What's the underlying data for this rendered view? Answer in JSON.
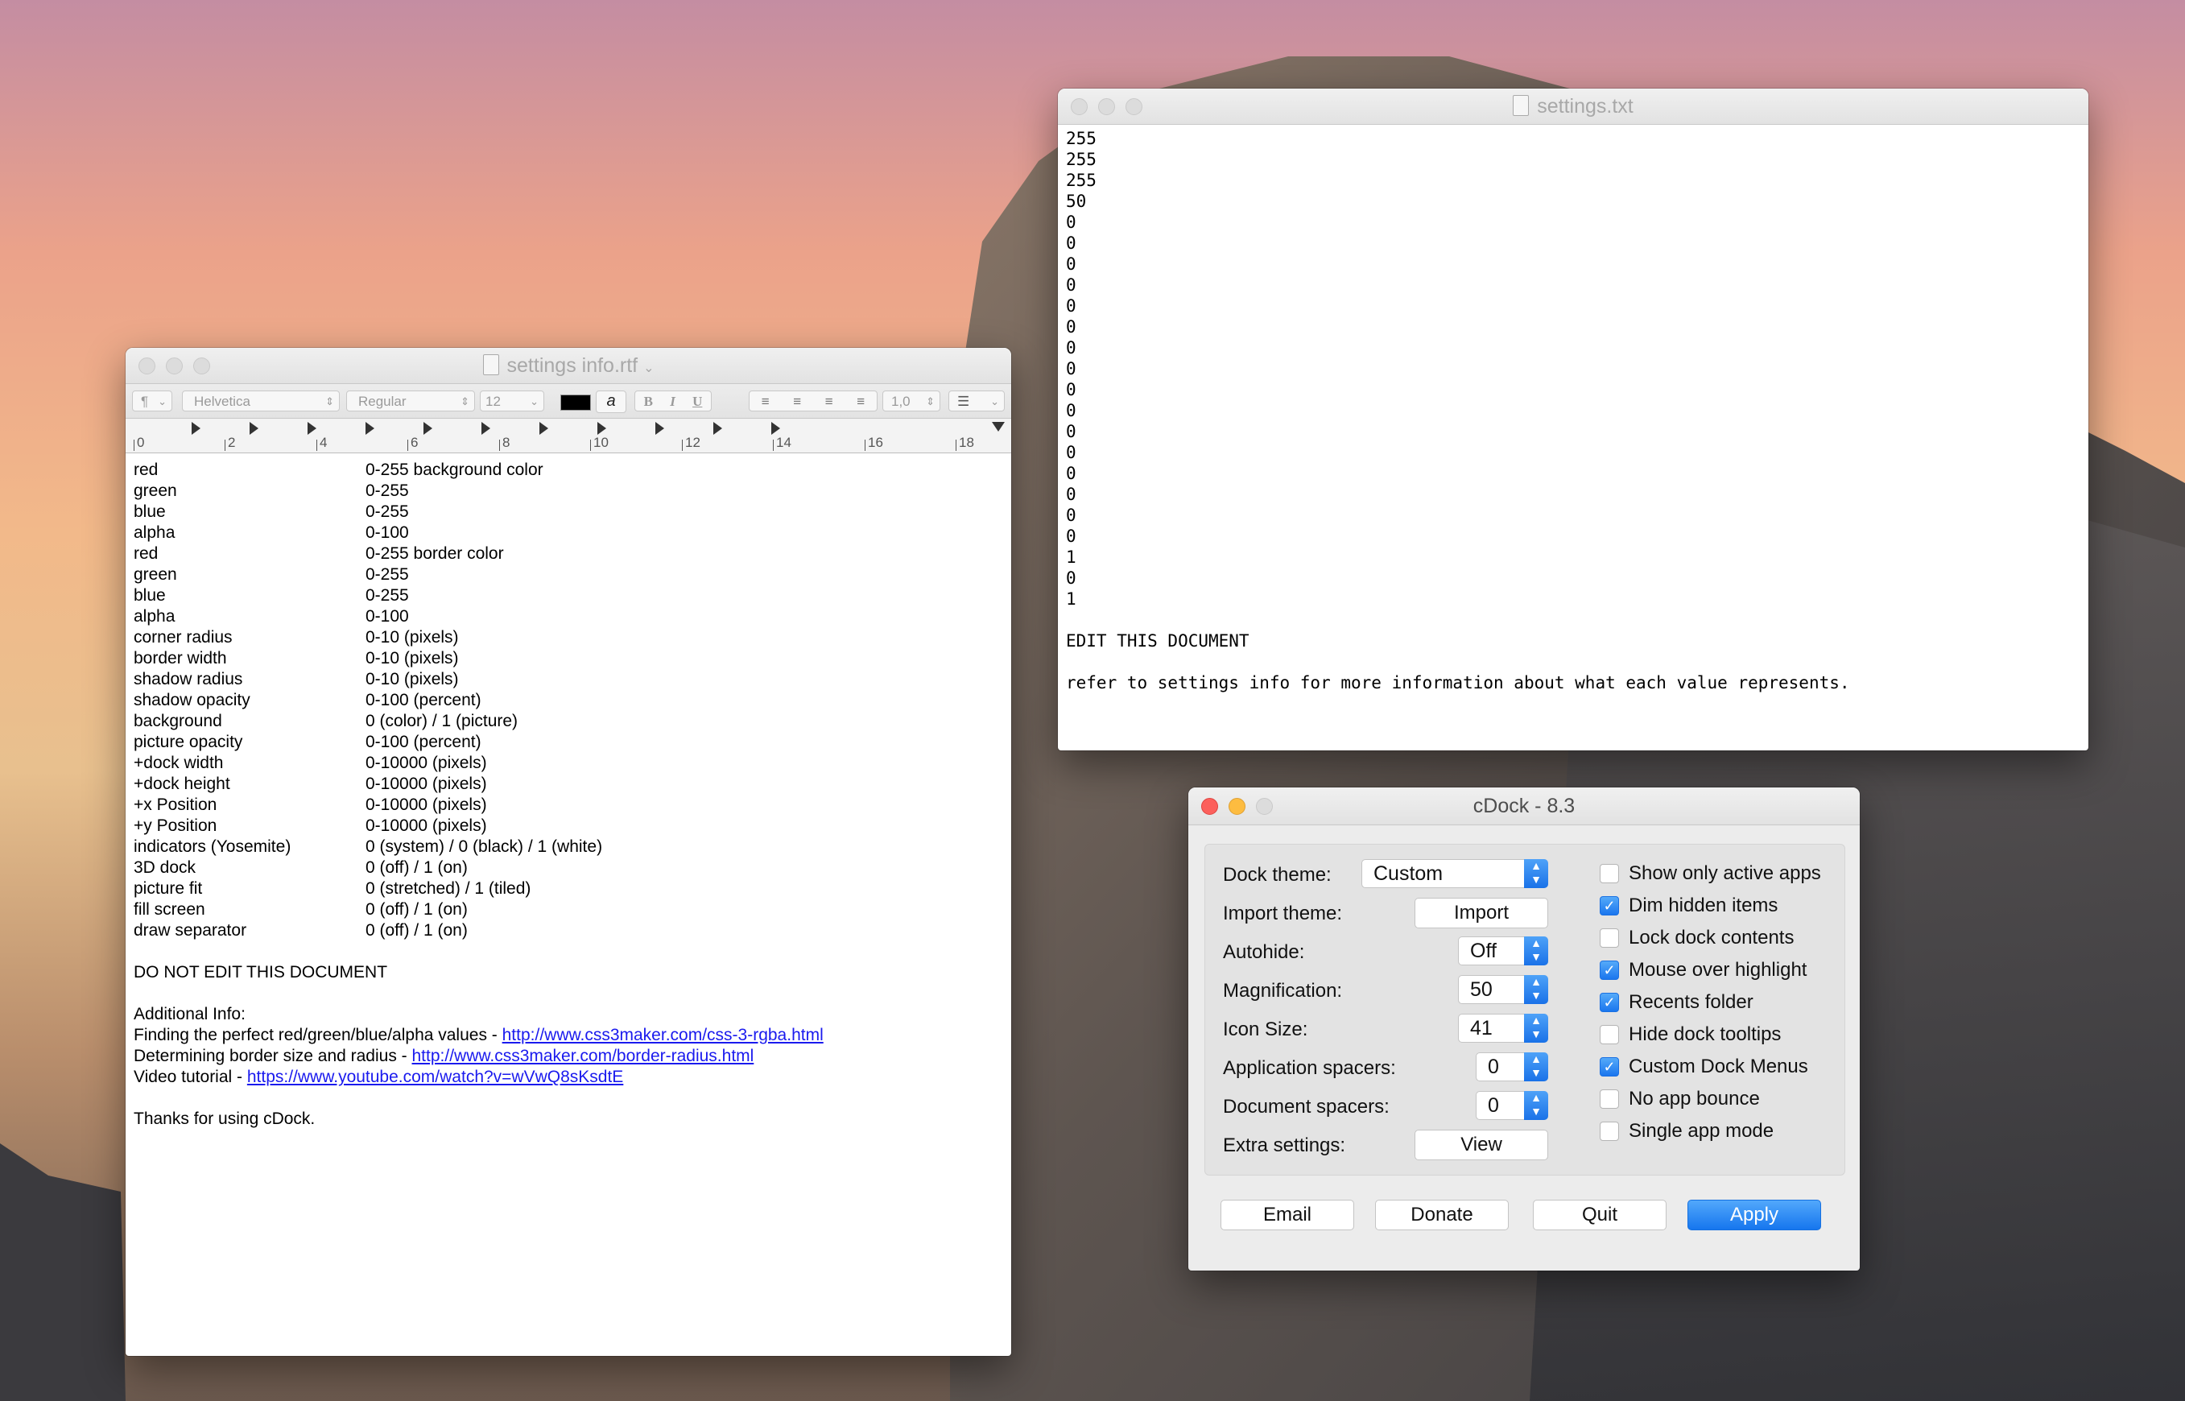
{
  "rtf_window": {
    "title": "settings info.rtf",
    "toolbar": {
      "paragraph": "¶",
      "font": "Helvetica",
      "style": "Regular",
      "size": "12",
      "bold": "B",
      "italic": "I",
      "underline": "U",
      "spacing": "1,0",
      "highlight_glyph": "a"
    },
    "ruler_numbers": [
      "0",
      "2",
      "4",
      "6",
      "8",
      "10",
      "12",
      "14",
      "16",
      "18"
    ],
    "settings": [
      {
        "name": "red",
        "desc": "0-255 background color"
      },
      {
        "name": "green",
        "desc": "0-255"
      },
      {
        "name": "blue",
        "desc": "0-255"
      },
      {
        "name": "alpha",
        "desc": "0-100"
      },
      {
        "name": "red",
        "desc": "0-255 border color"
      },
      {
        "name": "green",
        "desc": "0-255"
      },
      {
        "name": "blue",
        "desc": "0-255"
      },
      {
        "name": "alpha",
        "desc": "0-100"
      },
      {
        "name": "corner radius",
        "desc": "0-10 (pixels)"
      },
      {
        "name": "border width",
        "desc": "0-10 (pixels)"
      },
      {
        "name": "shadow radius",
        "desc": "0-10 (pixels)"
      },
      {
        "name": "shadow opacity",
        "desc": "0-100 (percent)"
      },
      {
        "name": "background",
        "desc": "0 (color) / 1 (picture)"
      },
      {
        "name": "picture opacity",
        "desc": "0-100 (percent)"
      },
      {
        "name": "+dock width",
        "desc": "0-10000 (pixels)"
      },
      {
        "name": "+dock height",
        "desc": "0-10000 (pixels)"
      },
      {
        "name": "+x Position",
        "desc": "0-10000 (pixels)"
      },
      {
        "name": "+y Position",
        "desc": "0-10000 (pixels)"
      },
      {
        "name": "indicators (Yosemite)",
        "desc": "0 (system) / 0 (black) / 1 (white)"
      },
      {
        "name": "3D dock",
        "desc": "0 (off) / 1 (on)"
      },
      {
        "name": "picture fit",
        "desc": "0 (stretched) / 1 (tiled)"
      },
      {
        "name": "fill screen",
        "desc": "0 (off) / 1 (on)"
      },
      {
        "name": "draw separator",
        "desc": "0 (off) / 1 (on)"
      }
    ],
    "do_not_edit": "DO NOT EDIT THIS DOCUMENT",
    "additional_info": "Additional Info:",
    "info_lines": [
      {
        "text": "Finding the perfect red/green/blue/alpha values - ",
        "link": "http://www.css3maker.com/css-3-rgba.html"
      },
      {
        "text": "Determining border size and radius - ",
        "link": "http://www.css3maker.com/border-radius.html"
      },
      {
        "text": "Video tutorial - ",
        "link": "https://www.youtube.com/watch?v=wVwQ8sKsdtE"
      }
    ],
    "thanks": "Thanks for using cDock."
  },
  "txt_window": {
    "title": "settings.txt",
    "values": [
      "255",
      "255",
      "255",
      "50",
      "0",
      "0",
      "0",
      "0",
      "0",
      "0",
      "0",
      "0",
      "0",
      "0",
      "0",
      "0",
      "0",
      "0",
      "0",
      "0",
      "1",
      "0",
      "1"
    ],
    "edit_line": "EDIT THIS DOCUMENT",
    "refer_line": "refer to settings info for more information about what each value represents."
  },
  "cdock_window": {
    "title": "cDock - 8.3",
    "labels": {
      "dock_theme": "Dock theme:",
      "import_theme": "Import theme:",
      "autohide": "Autohide:",
      "magnification": "Magnification:",
      "icon_size": "Icon Size:",
      "app_spacers": "Application spacers:",
      "doc_spacers": "Document spacers:",
      "extra_settings": "Extra settings:"
    },
    "values": {
      "dock_theme": "Custom",
      "import_button": "Import",
      "autohide": "Off",
      "magnification": "50",
      "icon_size": "41",
      "app_spacers": "0",
      "doc_spacers": "0",
      "view_button": "View"
    },
    "checkboxes": [
      {
        "label": "Show only active apps",
        "checked": false
      },
      {
        "label": "Dim hidden items",
        "checked": true
      },
      {
        "label": "Lock dock contents",
        "checked": false
      },
      {
        "label": "Mouse over highlight",
        "checked": true
      },
      {
        "label": "Recents folder",
        "checked": true
      },
      {
        "label": "Hide dock tooltips",
        "checked": false
      },
      {
        "label": "Custom Dock Menus",
        "checked": true
      },
      {
        "label": "No app bounce",
        "checked": false
      },
      {
        "label": "Single app mode",
        "checked": false
      }
    ],
    "buttons": {
      "email": "Email",
      "donate": "Donate",
      "quit": "Quit",
      "apply": "Apply"
    }
  }
}
